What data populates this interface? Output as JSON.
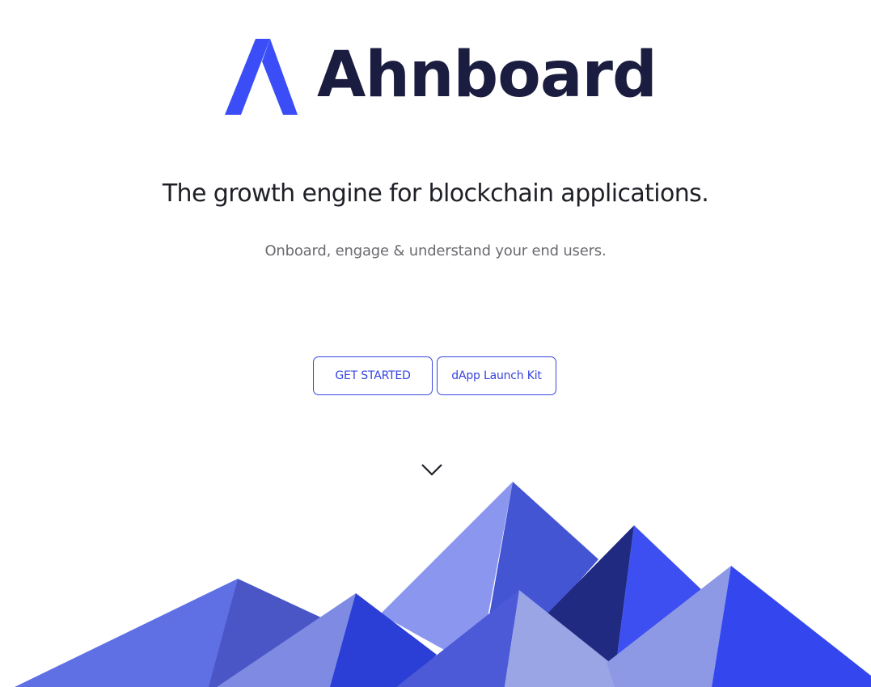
{
  "brand": {
    "name": "Ahnboard",
    "mark_color": "#3b4df6",
    "text_color": "#1a1d3f"
  },
  "hero": {
    "headline": "The growth engine for blockchain applications.",
    "subheadline": "Onboard, engage & understand your end users."
  },
  "actions": {
    "get_started_label": "GET STARTED",
    "launch_kit_label": "dApp Launch Kit",
    "accent_color": "#3744e0"
  },
  "scroll_hint": {
    "icon": "chevron-down-icon"
  },
  "illustration": {
    "icon": "mountains-illustration",
    "palette": [
      "#5f6fe4",
      "#4a56c6",
      "#8b97ef",
      "#4455d4",
      "#1f2a80",
      "#3d4ff0",
      "#9aa5e6",
      "#2b3fd6",
      "#3447ef"
    ]
  }
}
